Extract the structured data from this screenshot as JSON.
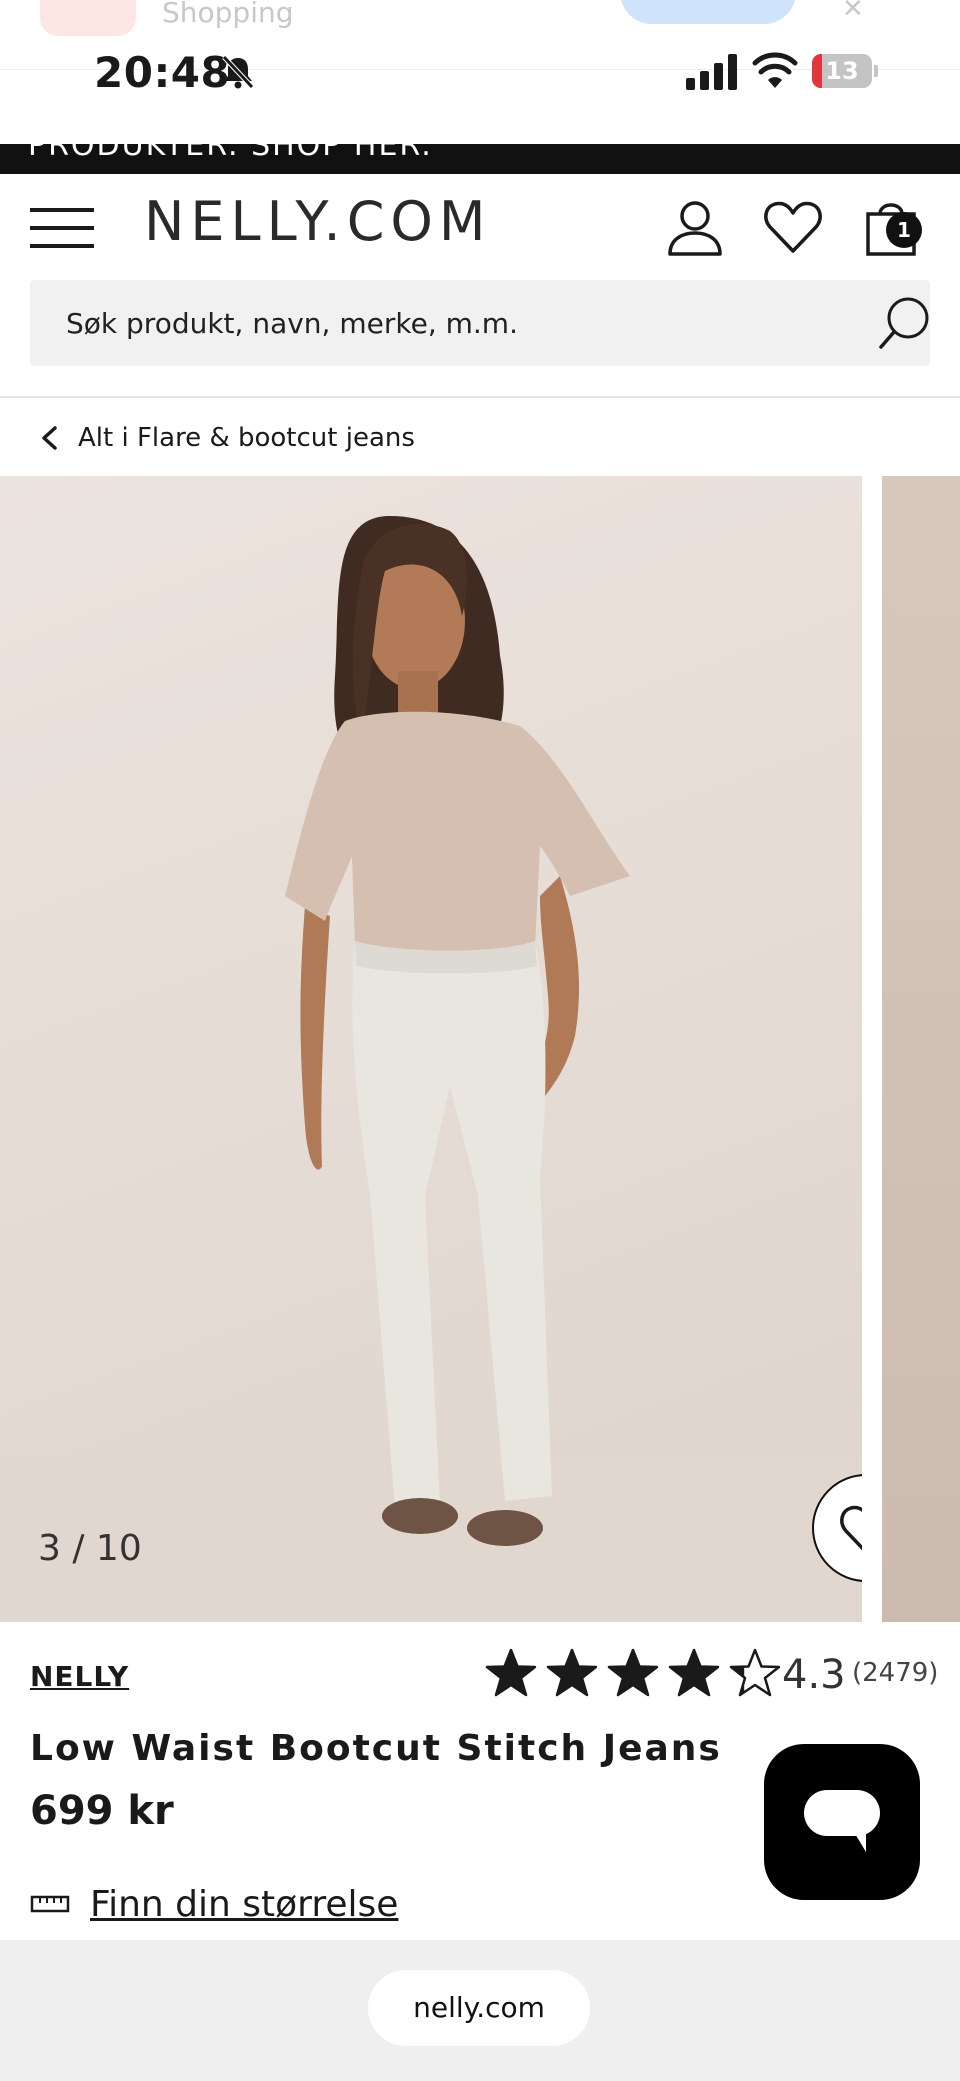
{
  "app_peek": {
    "name": "Shopping"
  },
  "status_bar": {
    "time": "20:48",
    "battery": "13"
  },
  "promo": {
    "text": "PRODUKTER. SHOP HER."
  },
  "header": {
    "logo": "NELLY.COM",
    "cart_count": "1"
  },
  "search": {
    "placeholder": "Søk produkt, navn, merke, m.m."
  },
  "breadcrumb": {
    "label": "Alt i Flare & bootcut jeans"
  },
  "gallery": {
    "counter": "3 / 10"
  },
  "product": {
    "brand": "NELLY",
    "rating": "4.3",
    "rating_value": 4.3,
    "reviews": "(2479)",
    "title": "Low Waist Bootcut Stitch Jeans",
    "price": "699 kr",
    "size_link": "Finn din størrelse"
  },
  "browser": {
    "url": "nelly.com"
  },
  "colors": {
    "accent": "#111111",
    "search_bg": "#f1f1f2",
    "battery_low": "#e0363c"
  },
  "icons": [
    "hamburger-icon",
    "account-icon",
    "heart-icon",
    "cart-icon",
    "search-icon",
    "chevron-left-icon",
    "heart-outline-icon",
    "star-icon",
    "chat-icon",
    "ruler-icon"
  ]
}
